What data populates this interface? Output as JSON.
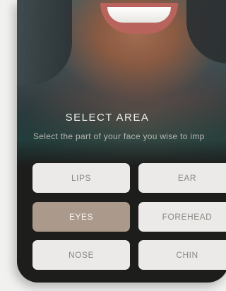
{
  "screen": {
    "title": "SELECT AREA",
    "subtitle": "Select the part of your face you wise to imp"
  },
  "options": [
    {
      "label": "LIPS",
      "selected": false
    },
    {
      "label": "EAR",
      "selected": false
    },
    {
      "label": "EYES",
      "selected": true
    },
    {
      "label": "FOREHEAD",
      "selected": false
    },
    {
      "label": "NOSE",
      "selected": false
    },
    {
      "label": "CHIN",
      "selected": false
    }
  ],
  "colors": {
    "selected": "#ab9a8c",
    "option": "#ebeae8",
    "background": "#1d1d1c"
  }
}
